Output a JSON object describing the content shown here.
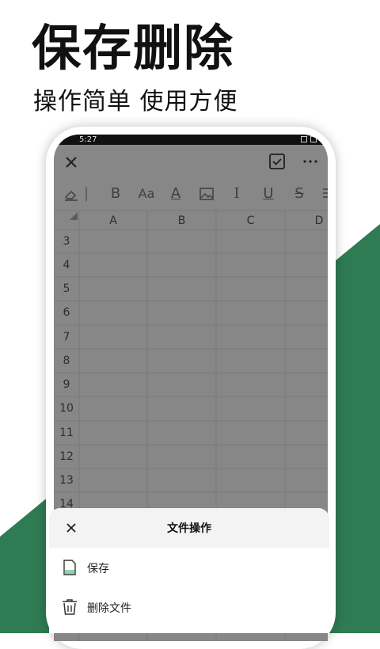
{
  "promo": {
    "title": "保存删除",
    "subtitle": "操作简单 使用方便"
  },
  "colors": {
    "brand_green": "#2f7b53",
    "screen_dim": "#878787"
  },
  "status_bar": {
    "time": "5:27"
  },
  "app_bar": {
    "close_icon": "close-icon",
    "done_icon": "check-box-icon",
    "more_icon": "more-horizontal-icon"
  },
  "toolbar": {
    "bold": "B",
    "font_size": "Aa",
    "text_color": "A",
    "italic": "I",
    "underline": "U",
    "strikethrough": "S"
  },
  "sheet": {
    "columns": [
      "A",
      "B",
      "C",
      "D"
    ],
    "rows": [
      "3",
      "4",
      "5",
      "6",
      "7",
      "8",
      "9",
      "10",
      "11",
      "12",
      "13",
      "14"
    ]
  },
  "bottom_sheet": {
    "title": "文件操作",
    "items": [
      {
        "label": "保存",
        "icon": "file-save-icon"
      },
      {
        "label": "删除文件",
        "icon": "trash-icon"
      }
    ]
  }
}
